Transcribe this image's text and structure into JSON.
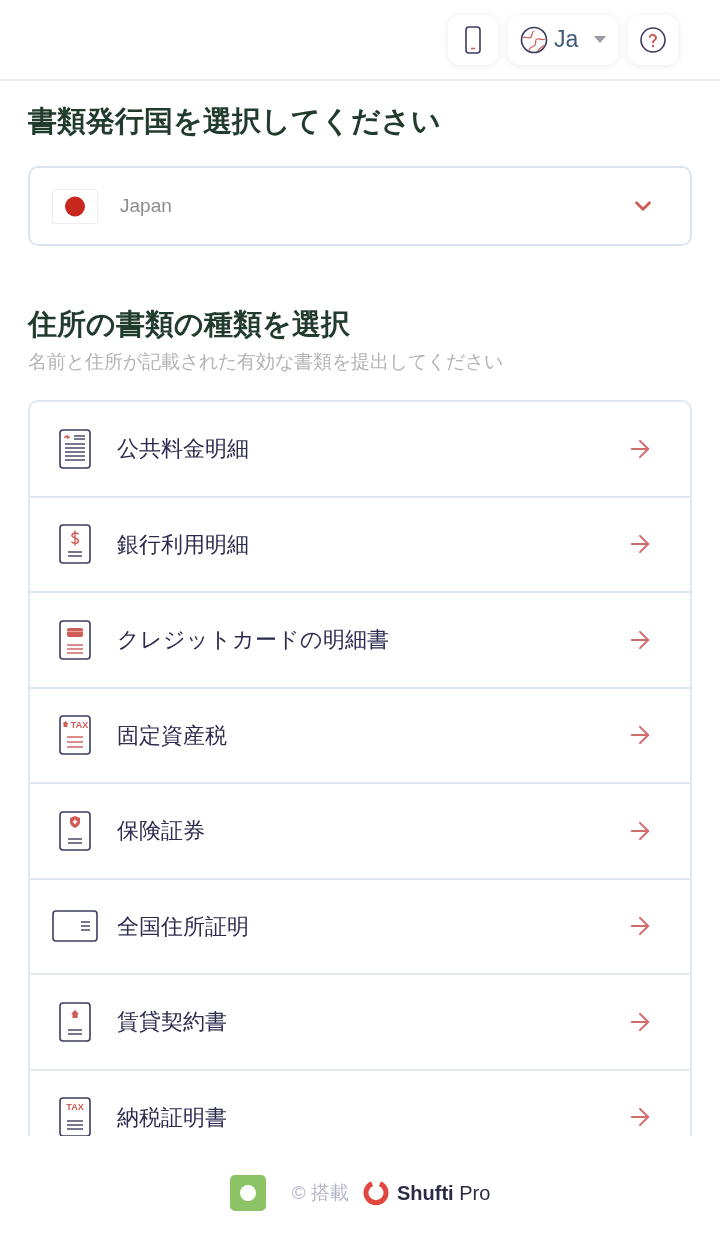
{
  "top_bar": {
    "language": "Ja"
  },
  "country_section": {
    "title": "書類発行国を選択してください",
    "select": {
      "value": "Japan"
    }
  },
  "document_section": {
    "title": "住所の書類の種類を選択",
    "subtitle": "名前と住所が記載された有効な書類を提出してください",
    "items": [
      {
        "kind": "utility",
        "label": "公共料金明細"
      },
      {
        "kind": "bank",
        "label": "銀行利用明細"
      },
      {
        "kind": "credit_card",
        "label": "クレジットカードの明細書"
      },
      {
        "kind": "property_tax",
        "label": "固定資産税",
        "icon_text": "TAX"
      },
      {
        "kind": "insurance",
        "label": "保険証券"
      },
      {
        "kind": "national_id",
        "label": "全国住所証明"
      },
      {
        "kind": "rental",
        "label": "賃貸契約書"
      },
      {
        "kind": "tax",
        "label": "納税証明書",
        "icon_text": "TAX"
      }
    ]
  },
  "footer": {
    "powered_by": "© 搭載",
    "brand": "**Shufti** Pro"
  }
}
